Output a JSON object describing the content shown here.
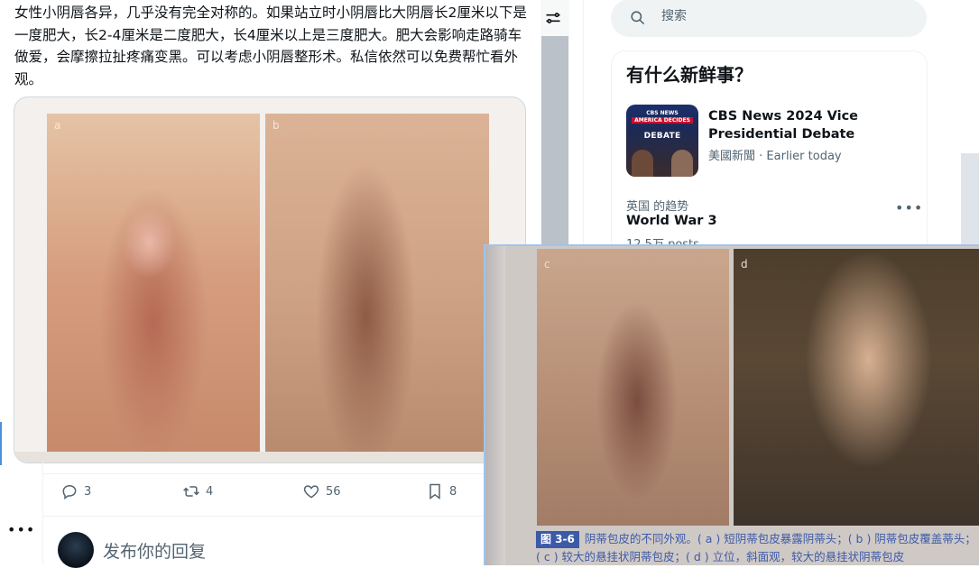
{
  "tweet": {
    "text": "女性小阴唇各异，几乎没有完全对称的。如果站立时小阴唇比大阴唇长2厘米以下是一度肥大，长2-4厘米是二度肥大，长4厘米以上是三度肥大。肥大会影响走路骑车做爱，会摩擦拉扯疼痛变黑。可以考虑小阴唇整形术。私信依然可以免费帮忙看外观。",
    "media_labels": [
      "a",
      "b"
    ],
    "actions": {
      "reply_count": "3",
      "retweet_count": "4",
      "like_count": "56",
      "bookmark_count": "8"
    }
  },
  "sidebar_more": "•••",
  "reply_composer": {
    "placeholder": "发布你的回复"
  },
  "search": {
    "placeholder": "搜索"
  },
  "trends": {
    "heading": "有什么新鲜事？",
    "news": {
      "thumb_lines": [
        "CBS NEWS",
        "AMERICA DECIDES",
        "DEBATE"
      ],
      "title": "CBS News 2024 Vice Presidential Debate",
      "source": "美國新聞",
      "time": "Earlier today"
    },
    "item": {
      "context": "英国 的趋势",
      "name": "World War 3",
      "count": "12.5万 posts"
    },
    "more": "•••"
  },
  "overlay": {
    "labels": [
      "c",
      "d"
    ],
    "figure_tag": "图 3-6",
    "caption": "阴蒂包皮的不同外观。( a ) 短阴蒂包皮暴露阴蒂头；( b ) 阴蒂包皮覆盖蒂头；( c ) 较大的悬挂状阴蒂包皮；( d ) 立位，斜面观，较大的悬挂状阴蒂包皮"
  },
  "colors": {
    "text": "#0f1419",
    "muted": "#536471",
    "border": "#eff3f4",
    "caption_blue": "#3c5aa8",
    "overlay_border": "#9fc4ee"
  }
}
